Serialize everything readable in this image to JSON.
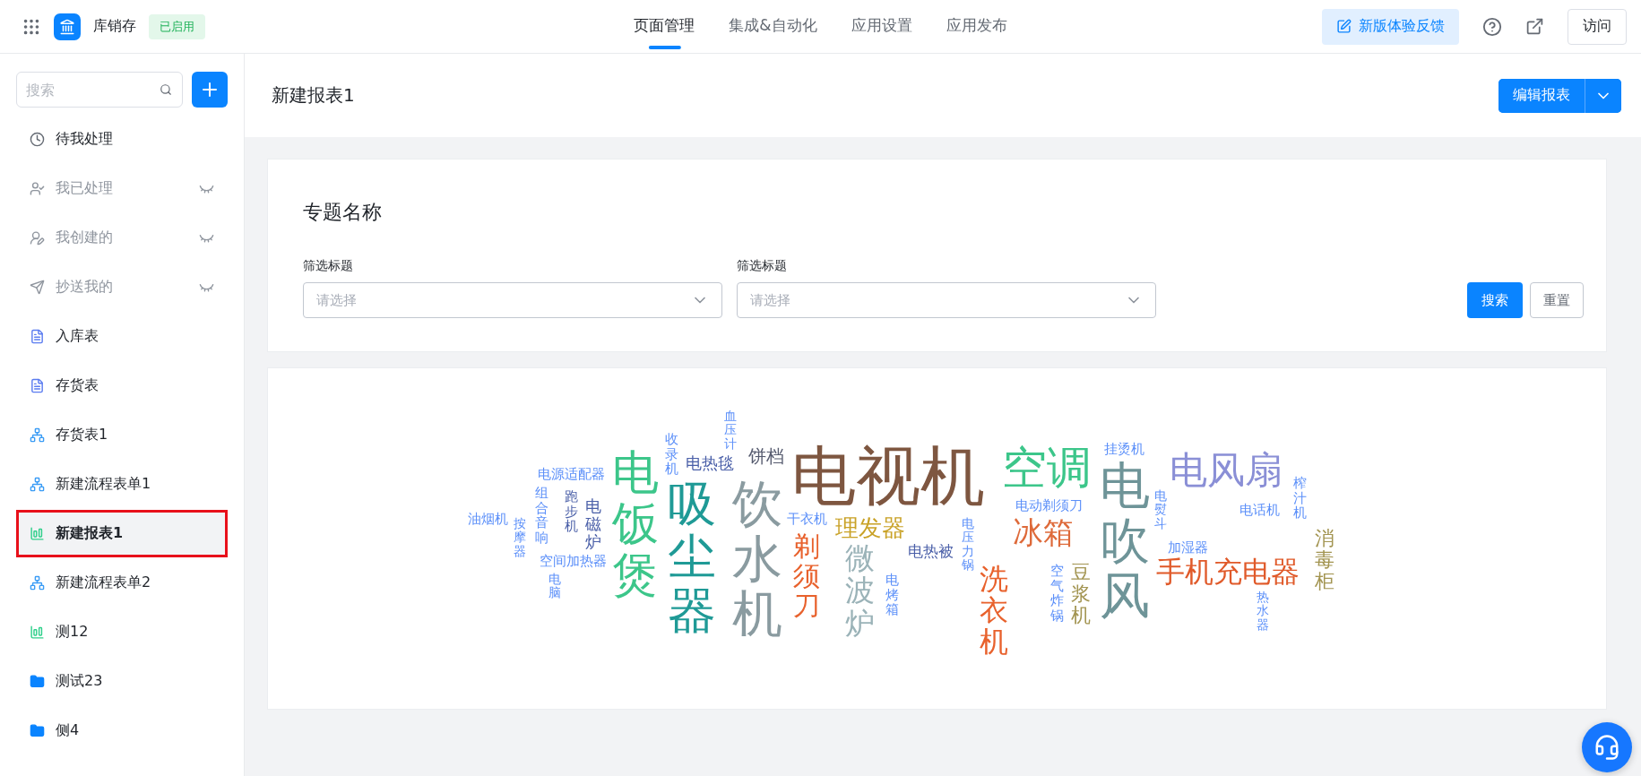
{
  "header": {
    "app_name": "库销存",
    "status_badge": "已启用",
    "tabs": [
      {
        "label": "页面管理",
        "selected": true
      },
      {
        "label": "集成&自动化",
        "selected": false
      },
      {
        "label": "应用设置",
        "selected": false
      },
      {
        "label": "应用发布",
        "selected": false
      }
    ],
    "feedback_button": "新版体验反馈",
    "visit_button": "访问"
  },
  "sidebar": {
    "search": {
      "placeholder": "搜索"
    },
    "items": [
      {
        "label": "待我处理",
        "kind": "clock",
        "hidden": false,
        "selected": false
      },
      {
        "label": "我已处理",
        "kind": "user-check",
        "hidden": true,
        "selected": false
      },
      {
        "label": "我创建的",
        "kind": "user-out",
        "hidden": true,
        "selected": false
      },
      {
        "label": "抄送我的",
        "kind": "send",
        "hidden": true,
        "selected": false
      },
      {
        "label": "入库表",
        "kind": "form",
        "hidden": false,
        "selected": false
      },
      {
        "label": "存货表",
        "kind": "form",
        "hidden": false,
        "selected": false
      },
      {
        "label": "存货表1",
        "kind": "flow",
        "hidden": false,
        "selected": false
      },
      {
        "label": "新建流程表单1",
        "kind": "flow",
        "hidden": false,
        "selected": false
      },
      {
        "label": "新建报表1",
        "kind": "report",
        "hidden": false,
        "selected": true
      },
      {
        "label": "新建流程表单2",
        "kind": "flow",
        "hidden": false,
        "selected": false
      },
      {
        "label": "测12",
        "kind": "report",
        "hidden": false,
        "selected": false
      },
      {
        "label": "测试23",
        "kind": "folder",
        "hidden": false,
        "selected": false
      },
      {
        "label": "侧4",
        "kind": "folder",
        "hidden": false,
        "selected": false
      }
    ]
  },
  "page": {
    "title": "新建报表1",
    "edit_button": "编辑报表"
  },
  "filter_card": {
    "title": "专题名称",
    "filters": [
      {
        "label": "筛选标题",
        "placeholder": "请选择"
      },
      {
        "label": "筛选标题",
        "placeholder": "请选择"
      }
    ],
    "search_button": "搜索",
    "reset_button": "重置"
  },
  "word_cloud": {
    "words": [
      {
        "text": "油烟机",
        "color": "#5b8ff9",
        "kind": "horizontal"
      },
      {
        "text": "按摩器",
        "color": "#5b8ff9",
        "kind": "vertical"
      },
      {
        "text": "电源适配器",
        "color": "#5b8ff9",
        "kind": "horizontal"
      },
      {
        "text": "组合音响",
        "color": "#5b8ff9",
        "kind": "vertical"
      },
      {
        "text": "跑步机",
        "color": "#4a5fa8",
        "kind": "vertical"
      },
      {
        "text": "电磁炉",
        "color": "#4a5fa8",
        "kind": "vertical"
      },
      {
        "text": "空间加热器",
        "color": "#5b8ff9",
        "kind": "horizontal"
      },
      {
        "text": "电脑",
        "color": "#5b8ff9",
        "kind": "vertical"
      },
      {
        "text": "电饭煲",
        "color": "#3cc68a",
        "kind": "vertical"
      },
      {
        "text": "收录机",
        "color": "#5b8ff9",
        "kind": "vertical"
      },
      {
        "text": "电热毯",
        "color": "#4a5fa8",
        "kind": "horizontal"
      },
      {
        "text": "吸尘器",
        "color": "#1f9a96",
        "kind": "vertical"
      },
      {
        "text": "血压计",
        "color": "#5b8ff9",
        "kind": "vertical"
      },
      {
        "text": "饼档",
        "color": "#555a6e",
        "kind": "horizontal"
      },
      {
        "text": "饮水机",
        "color": "#8a9ba0",
        "kind": "vertical"
      },
      {
        "text": "电视机",
        "color": "#7e5640",
        "kind": "horizontal"
      },
      {
        "text": "干衣机",
        "color": "#5b8ff9",
        "kind": "horizontal"
      },
      {
        "text": "剃须刀",
        "color": "#e8612c",
        "kind": "vertical"
      },
      {
        "text": "理发器",
        "color": "#c9a227",
        "kind": "horizontal"
      },
      {
        "text": "微波炉",
        "color": "#9bb3b8",
        "kind": "vertical"
      },
      {
        "text": "电烤箱",
        "color": "#5b8ff9",
        "kind": "vertical"
      },
      {
        "text": "电热被",
        "color": "#4a5fa8",
        "kind": "horizontal"
      },
      {
        "text": "电压力锅",
        "color": "#5b8ff9",
        "kind": "vertical"
      },
      {
        "text": "空调",
        "color": "#3cc68a",
        "kind": "horizontal"
      },
      {
        "text": "洗衣机",
        "color": "#e8612c",
        "kind": "vertical"
      },
      {
        "text": "电动剃须刀",
        "color": "#5b8ff9",
        "kind": "horizontal"
      },
      {
        "text": "冰箱",
        "color": "#de6a3a",
        "kind": "horizontal"
      },
      {
        "text": "空气炸锅",
        "color": "#5b8ff9",
        "kind": "vertical"
      },
      {
        "text": "豆浆机",
        "color": "#a39552",
        "kind": "vertical"
      },
      {
        "text": "挂烫机",
        "color": "#5b8ff9",
        "kind": "horizontal"
      },
      {
        "text": "电吹风",
        "color": "#6e9498",
        "kind": "vertical"
      },
      {
        "text": "电熨斗",
        "color": "#5b8ff9",
        "kind": "vertical"
      },
      {
        "text": "电风扇",
        "color": "#8a8fd6",
        "kind": "horizontal"
      },
      {
        "text": "加湿器",
        "color": "#5b8ff9",
        "kind": "horizontal"
      },
      {
        "text": "电话机",
        "color": "#5b8ff9",
        "kind": "horizontal"
      },
      {
        "text": "榨汁机",
        "color": "#5b8ff9",
        "kind": "vertical"
      },
      {
        "text": "手机充电器",
        "color": "#e05a2a",
        "kind": "horizontal"
      },
      {
        "text": "热水器",
        "color": "#5b8ff9",
        "kind": "vertical"
      },
      {
        "text": "消毒柜",
        "color": "#a39552",
        "kind": "vertical"
      }
    ]
  }
}
